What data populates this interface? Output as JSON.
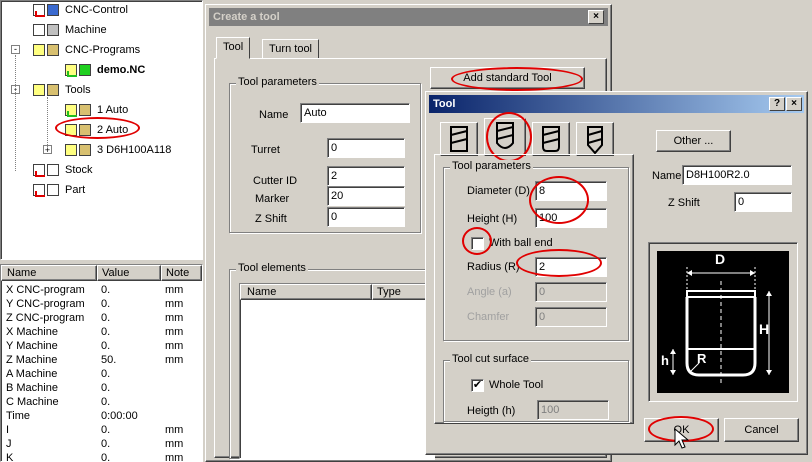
{
  "tree": {
    "items": [
      {
        "label": "CNC-Control"
      },
      {
        "label": "Machine"
      },
      {
        "label": "CNC-Programs"
      },
      {
        "label": "demo.NC"
      },
      {
        "label": "Tools"
      },
      {
        "label": "1 Auto"
      },
      {
        "label": "2 Auto"
      },
      {
        "label": "3 D6H100A118"
      },
      {
        "label": "Stock"
      },
      {
        "label": "Part"
      }
    ]
  },
  "grid": {
    "headers": [
      "Name",
      "Value",
      "Note"
    ],
    "rows": [
      {
        "name": "X CNC-program",
        "value": "0.",
        "note": "mm"
      },
      {
        "name": "Y CNC-program",
        "value": "0.",
        "note": "mm"
      },
      {
        "name": "Z CNC-program",
        "value": "0.",
        "note": "mm"
      },
      {
        "name": "X Machine",
        "value": "0.",
        "note": "mm"
      },
      {
        "name": "Y Machine",
        "value": "0.",
        "note": "mm"
      },
      {
        "name": "Z Machine",
        "value": "50.",
        "note": "mm"
      },
      {
        "name": "A Machine",
        "value": "0.",
        "note": ""
      },
      {
        "name": "B Machine",
        "value": "0.",
        "note": ""
      },
      {
        "name": "C Machine",
        "value": "0.",
        "note": ""
      },
      {
        "name": "Time",
        "value": "0:00:00",
        "note": ""
      },
      {
        "name": "I",
        "value": "0.",
        "note": "mm"
      },
      {
        "name": "J",
        "value": "0.",
        "note": "mm"
      },
      {
        "name": "K",
        "value": "0.",
        "note": "mm"
      }
    ]
  },
  "create_tool": {
    "title": "Create a tool",
    "close": "×",
    "tabs": [
      "Tool",
      "Turn tool"
    ],
    "params_group": "Tool parameters",
    "name_label": "Name",
    "name_value": "Auto",
    "turret_label": "Turret",
    "turret_value": "0",
    "cutter_label": "Cutter ID",
    "cutter_value": "2",
    "marker_label": "Marker",
    "marker_value": "20",
    "zshift_label": "Z Shift",
    "zshift_value": "0",
    "add_button": "Add standard Tool",
    "elements_group": "Tool elements",
    "elements_headers": [
      "Name",
      "Type"
    ]
  },
  "tool_dialog": {
    "title": "Tool",
    "help": "?",
    "close": "×",
    "params_group": "Tool parameters",
    "diameter_label": "Diameter (D)",
    "diameter_value": "8",
    "height_label": "Height (H)",
    "height_value": "100",
    "ball_label": "With ball end",
    "radius_label": "Radius (R)",
    "radius_value": "2",
    "angle_label": "Angle (a)",
    "angle_value": "0",
    "chamfer_label": "Chamfer",
    "chamfer_value": "0",
    "cut_group": "Tool cut surface",
    "whole_label": "Whole Tool",
    "whole_check": "✔",
    "heigth_label": "Heigth (h)",
    "heigth_value": "100",
    "other_button": "Other ...",
    "name_label": "Name",
    "name_value": "D8H100R2.0",
    "zshift_label": "Z Shift",
    "zshift_value": "0",
    "diagram": {
      "d": "D",
      "h_big": "H",
      "h_small": "h",
      "r": "R"
    },
    "ok_button": "OK",
    "cancel_button": "Cancel"
  },
  "colors": {
    "title_active": "#0a246a",
    "title_inactive": "#808080",
    "annotation": "#e00000"
  }
}
